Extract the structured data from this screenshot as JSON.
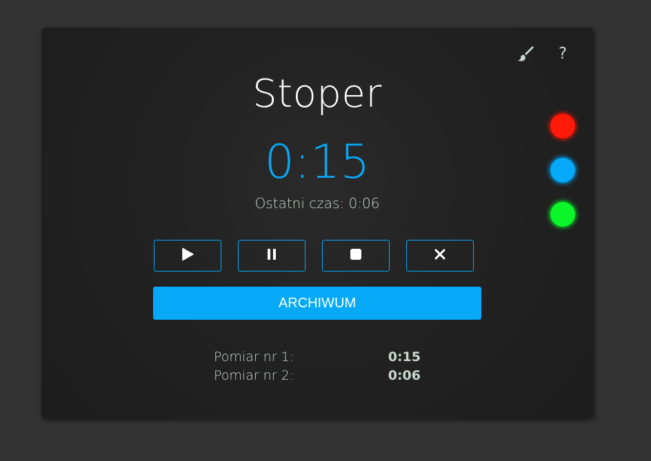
{
  "app": {
    "title": "Stoper",
    "timer": "0:15",
    "last_time": "Ostatni czas: 0:06"
  },
  "top_icons": {
    "brush_icon": "paint-brush-icon",
    "help_label": "?"
  },
  "controls": [
    {
      "name": "start-button",
      "icon": "play-icon"
    },
    {
      "name": "pause-button",
      "icon": "pause-icon"
    },
    {
      "name": "stop-button",
      "icon": "stop-icon"
    },
    {
      "name": "reset-button",
      "icon": "close-icon"
    }
  ],
  "archive": {
    "label": "ARCHIWUM"
  },
  "results": [
    {
      "label": "Pomiar nr 1:",
      "value": "0:15"
    },
    {
      "label": "Pomiar nr 2:",
      "value": "0:06"
    }
  ],
  "theme_colors": [
    {
      "name": "red",
      "hex": "#ff1a0a",
      "glow": "#ff1a0a"
    },
    {
      "name": "blue",
      "hex": "#06a9f7",
      "glow": "#06a9f7"
    },
    {
      "name": "green",
      "hex": "#0cf52a",
      "glow": "#0cf52a"
    }
  ],
  "colors": {
    "accent": "#06a9f7",
    "text_muted": "#c9d7cf",
    "background": "#333333",
    "card": "#222222"
  }
}
